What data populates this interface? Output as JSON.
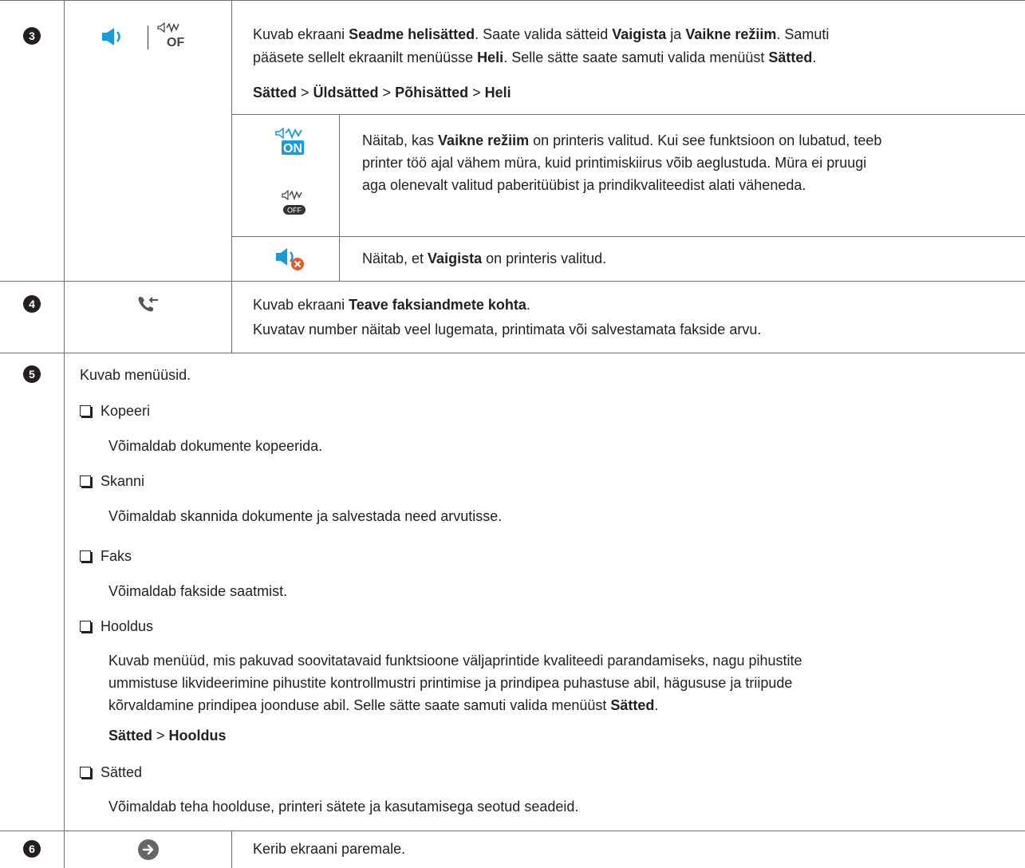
{
  "rows": {
    "r3": {
      "number": "3",
      "icon_names": [
        "speaker-icon",
        "quiet-off-icon"
      ],
      "desc": {
        "p1_a": "Kuvab ekraani ",
        "p1_b": "Seadme helisätted",
        "p1_c": ". Saate valida sätteid ",
        "p1_d": "Vaigista",
        "p1_e": " ja ",
        "p1_f": "Vaikne režiim",
        "p1_g": ". Samuti",
        "p2_a": "pääsete sellelt ekraanilt menüüsse ",
        "p2_b": "Heli",
        "p2_c": ". Selle sätte saate samuti valida menüüst ",
        "p2_d": "Sätted",
        "p2_e": ".",
        "path": [
          "Sätted",
          "Üldsätted",
          "Põhisätted",
          "Heli"
        ],
        "sep": " > "
      },
      "sub": [
        {
          "icons": [
            "quiet-mode-on-icon",
            "quiet-mode-off-icon"
          ],
          "on_label": "ON",
          "off_label": "OFF",
          "text_a": "Näitab, kas ",
          "text_b": "Vaikne režiim",
          "text_c": " on printeris valitud. Kui see funktsioon on lubatud, teeb",
          "line2": "printer töö ajal vähem müra, kuid printimiskiirus võib aeglustuda. Müra ei pruugi",
          "line3": "aga olenevalt valitud paberitüübist ja prindikvaliteedist alati väheneda."
        },
        {
          "icons": [
            "mute-icon"
          ],
          "text_a": "Näitab, et ",
          "text_b": "Vaigista",
          "text_c": " on printeris valitud."
        }
      ]
    },
    "r4": {
      "number": "4",
      "icon_names": [
        "fax-info-icon"
      ],
      "line1_a": "Kuvab ekraani ",
      "line1_b": "Teave faksiandmete kohta",
      "line1_c": ".",
      "line2": "Kuvatav number näitab veel lugemata, printimata või salvestamata fakside arvu."
    },
    "r5": {
      "number": "5",
      "intro": "Kuvab menüüsid.",
      "items": [
        {
          "label": "Kopeeri",
          "desc": "Võimaldab dokumente kopeerida."
        },
        {
          "label": "Skanni",
          "desc": "Võimaldab skannida dokumente ja salvestada need arvutisse."
        },
        {
          "label": "Faks",
          "desc": "Võimaldab fakside saatmist."
        },
        {
          "label": "Hooldus",
          "desc_l1": "Kuvab menüüd, mis pakuvad soovitatavaid funktsioone väljaprintide kvaliteedi parandamiseks, nagu pihustite",
          "desc_l2": "ummistuse likvideerimine pihustite kontrollmustri printimise ja prindipea puhastuse abil, hägususe ja triipude",
          "desc_l3a": "kõrvaldamine prindipea joonduse abil. Selle sätte saate samuti valida menüüst ",
          "desc_l3b": "Sätted",
          "desc_l3c": ".",
          "path_a": "Sätted",
          "path_sep": " > ",
          "path_b": "Hooldus"
        },
        {
          "label": "Sätted",
          "desc": "Võimaldab teha hoolduse, printeri sätete ja kasutamisega seotud seadeid."
        }
      ]
    },
    "r6": {
      "number": "6",
      "icon_names": [
        "arrow-right-circle-icon"
      ],
      "text": "Kerib ekraani paremale."
    }
  },
  "colors": {
    "rule": "#6d6e71",
    "text": "#231f20",
    "accent_blue": "#1a9ad6",
    "mute_red": "#e05a2b",
    "icon_gray": "#555555"
  }
}
